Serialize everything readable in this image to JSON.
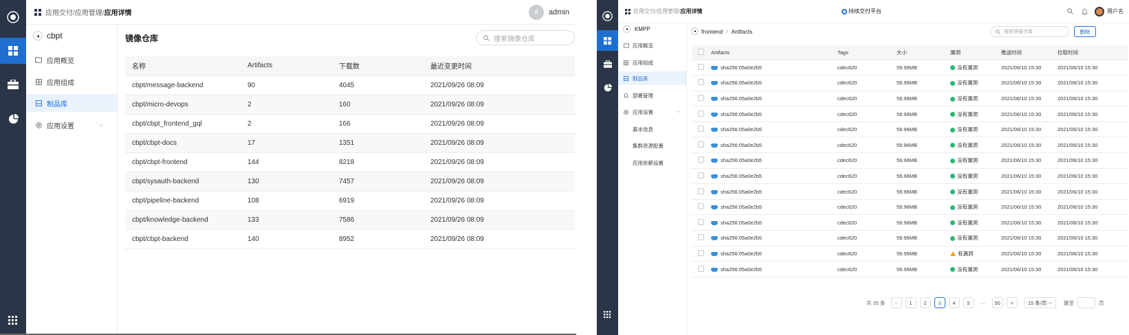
{
  "left": {
    "breadcrumb": {
      "part1": "应用交付/应用管理/",
      "current": "应用详情"
    },
    "user": {
      "avatar_letter": "a",
      "name": "admin"
    },
    "app_name": "cbpt",
    "nav": [
      {
        "label": "应用概览",
        "icon": "map-icon"
      },
      {
        "label": "应用组成",
        "icon": "grid-icon"
      },
      {
        "label": "制品库",
        "icon": "box-icon",
        "active": true
      },
      {
        "label": "应用设置",
        "icon": "settings-icon",
        "expandable": true
      }
    ],
    "page_title": "镜像仓库",
    "search_placeholder": "搜索镜像仓库",
    "table": {
      "headers": [
        "名称",
        "Artifacts",
        "下载数",
        "最近变更时间"
      ],
      "rows": [
        [
          "cbpt/message-backend",
          "90",
          "4045",
          "2021/09/26 08:09"
        ],
        [
          "cbpt/micro-devops",
          "2",
          "160",
          "2021/09/26 08:09"
        ],
        [
          "cbpt/cbpt_frontend_gql",
          "2",
          "166",
          "2021/09/26 08:09"
        ],
        [
          "cbpt/cbpt-docs",
          "17",
          "1351",
          "2021/09/26 08:09"
        ],
        [
          "cbpt/cbpt-frontend",
          "144",
          "8218",
          "2021/09/26 08:09"
        ],
        [
          "cbpt/sysauth-backend",
          "130",
          "7457",
          "2021/09/26 08:09"
        ],
        [
          "cbpt/pipeline-backend",
          "108",
          "6919",
          "2021/09/26 08:09"
        ],
        [
          "cbpt/knowledge-backend",
          "133",
          "7586",
          "2021/09/26 08:09"
        ],
        [
          "cbpt/cbpt-backend",
          "140",
          "8952",
          "2021/09/26 08:09"
        ]
      ]
    }
  },
  "right": {
    "breadcrumb": {
      "part1": "应用交付/应用管理/",
      "current": "应用详情"
    },
    "platform_label": "持续交付平台",
    "user_name": "用户名",
    "app_name": "KMPP",
    "nav": [
      {
        "label": "应用概览"
      },
      {
        "label": "应用组成"
      },
      {
        "label": "制品库",
        "active": true
      },
      {
        "label": "部署管理"
      },
      {
        "label": "应用设置",
        "expandable": true
      }
    ],
    "sub_nav": [
      "基本信息",
      "集群资源配置",
      "应用依赖设置"
    ],
    "path": {
      "repo": "frontend",
      "section": "Artifacts"
    },
    "search_placeholder": "搜索镜像仓库",
    "delete_label": "删除",
    "table": {
      "headers": [
        "Artifacts",
        "Tags",
        "大小",
        "漏洞",
        "推送时间",
        "拉取时间"
      ],
      "rows": [
        {
          "artifact": "sha256:05a0e2b5",
          "tag": "cdec620",
          "size": "59.96MB",
          "vuln": "没有漏洞",
          "ok": true,
          "push": "2021/06/10 15:30",
          "pull": "2021/06/10 15:30"
        },
        {
          "artifact": "sha256:05a0e2b5",
          "tag": "cdec620",
          "size": "59.96MB",
          "vuln": "没有漏洞",
          "ok": true,
          "push": "2021/06/10 15:30",
          "pull": "2021/06/10 15:30"
        },
        {
          "artifact": "sha256:05a0e2b5",
          "tag": "cdec620",
          "size": "59.96MB",
          "vuln": "没有漏洞",
          "ok": true,
          "push": "2021/06/10 15:30",
          "pull": "2021/06/10 15:30"
        },
        {
          "artifact": "sha256:05a0e2b5",
          "tag": "cdec620",
          "size": "59.96MB",
          "vuln": "没有漏洞",
          "ok": true,
          "push": "2021/06/10 15:30",
          "pull": "2021/06/10 15:30"
        },
        {
          "artifact": "sha256:05a0e2b5",
          "tag": "cdec620",
          "size": "59.96MB",
          "vuln": "没有漏洞",
          "ok": true,
          "push": "2021/06/10 15:30",
          "pull": "2021/06/10 15:30"
        },
        {
          "artifact": "sha256:05a0e2b5",
          "tag": "cdec620",
          "size": "59.96MB",
          "vuln": "没有漏洞",
          "ok": true,
          "push": "2021/06/10 15:30",
          "pull": "2021/06/10 15:30"
        },
        {
          "artifact": "sha256:05a0e2b5",
          "tag": "cdec620",
          "size": "59.96MB",
          "vuln": "没有漏洞",
          "ok": true,
          "push": "2021/06/10 15:30",
          "pull": "2021/06/10 15:30"
        },
        {
          "artifact": "sha256:05a0e2b5",
          "tag": "cdec620",
          "size": "59.96MB",
          "vuln": "没有漏洞",
          "ok": true,
          "push": "2021/06/10 15:30",
          "pull": "2021/06/10 15:30"
        },
        {
          "artifact": "sha256:05a0e2b5",
          "tag": "cdec620",
          "size": "59.96MB",
          "vuln": "没有漏洞",
          "ok": true,
          "push": "2021/06/10 15:30",
          "pull": "2021/06/10 15:30"
        },
        {
          "artifact": "sha256:05a0e2b5",
          "tag": "cdec620",
          "size": "59.96MB",
          "vuln": "没有漏洞",
          "ok": true,
          "push": "2021/06/10 15:30",
          "pull": "2021/06/10 15:30"
        },
        {
          "artifact": "sha256:05a0e2b5",
          "tag": "cdec620",
          "size": "59.96MB",
          "vuln": "没有漏洞",
          "ok": true,
          "push": "2021/06/10 15:30",
          "pull": "2021/06/10 15:30"
        },
        {
          "artifact": "sha256:05a0e2b5",
          "tag": "cdec620",
          "size": "59.96MB",
          "vuln": "没有漏洞",
          "ok": true,
          "push": "2021/06/10 15:30",
          "pull": "2021/06/10 15:30"
        },
        {
          "artifact": "sha256:05a0e2b5",
          "tag": "cdec620",
          "size": "59.96MB",
          "vuln": "有漏洞",
          "ok": false,
          "push": "2021/06/10 15:30",
          "pull": "2021/06/10 15:30"
        },
        {
          "artifact": "sha256:05a0e2b5",
          "tag": "cdec620",
          "size": "59.96MB",
          "vuln": "没有漏洞",
          "ok": true,
          "push": "2021/06/10 15:30",
          "pull": "2021/06/10 15:30"
        }
      ]
    },
    "pagination": {
      "total": "共 35 条",
      "pages": [
        "1",
        "2",
        "3",
        "4",
        "5",
        "···",
        "50"
      ],
      "current": "3",
      "page_size": "15 条/页",
      "jump_label": "跳至",
      "page_suffix": "页"
    }
  },
  "colors": {
    "rail": "#2a3547",
    "accent": "#1f6fd1",
    "ok": "#2bb673",
    "warn": "#f0a020"
  }
}
